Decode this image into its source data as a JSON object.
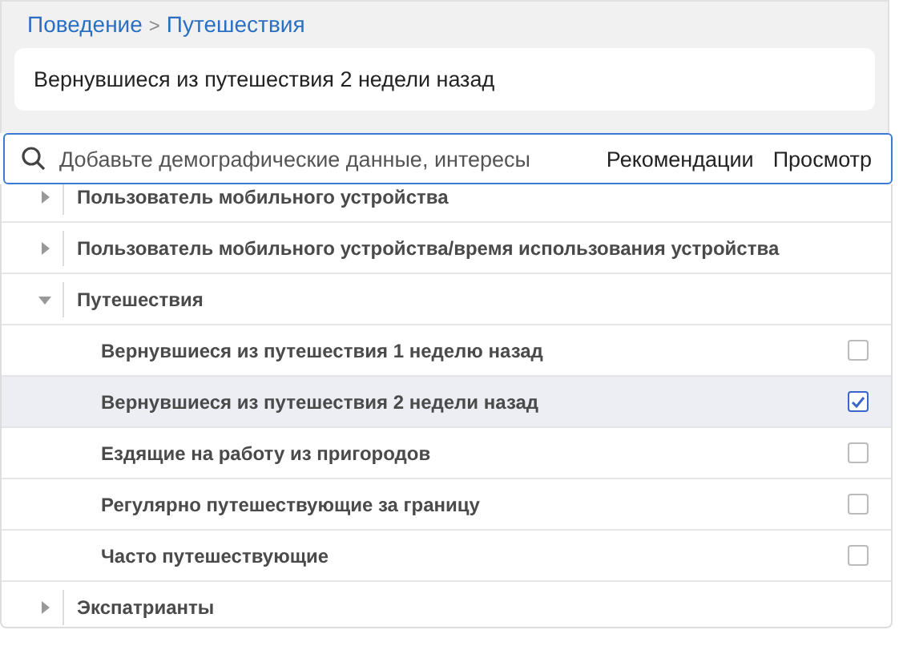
{
  "breadcrumb": {
    "items": [
      "Поведение",
      "Путешествия"
    ],
    "separator": ">"
  },
  "selection": {
    "chips": [
      "Вернувшиеся из путешествия 2 недели назад"
    ]
  },
  "search": {
    "placeholder": "Добавьте демографические данные, интересы",
    "tabs": [
      "Рекомендации",
      "Просмотр"
    ]
  },
  "tree": [
    {
      "label": "Пользователь мобильного устройства",
      "expanded": false
    },
    {
      "label": "Пользователь мобильного устройства/время использования устройства",
      "expanded": false
    },
    {
      "label": "Путешествия",
      "expanded": true,
      "children": [
        {
          "label": "Вернувшиеся из путешествия 1 неделю назад",
          "checked": false,
          "selected": false
        },
        {
          "label": "Вернувшиеся из путешествия 2 недели назад",
          "checked": true,
          "selected": true
        },
        {
          "label": "Ездящие на работу из пригородов",
          "checked": false,
          "selected": false
        },
        {
          "label": "Регулярно путешествующие за границу",
          "checked": false,
          "selected": false
        },
        {
          "label": "Часто путешествующие",
          "checked": false,
          "selected": false
        }
      ]
    },
    {
      "label": "Экспатрианты",
      "expanded": false
    }
  ]
}
